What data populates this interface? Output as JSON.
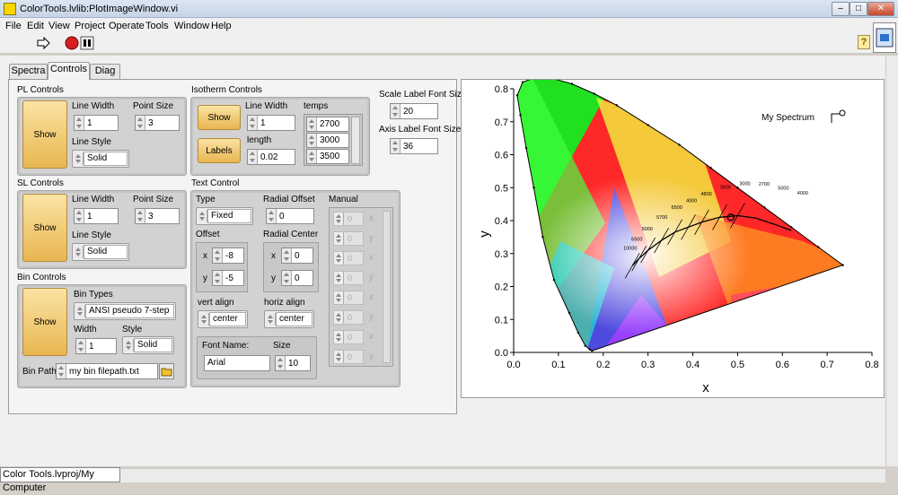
{
  "window": {
    "title": "ColorTools.lvlib:PlotImageWindow.vi",
    "min": "–",
    "max": "□",
    "close": "✕"
  },
  "menu": [
    "File",
    "Edit",
    "View",
    "Project",
    "Operate",
    "Tools",
    "Window",
    "Help"
  ],
  "help_label": "?",
  "tabs": [
    "Spectra",
    "Controls",
    "Diag"
  ],
  "pl": {
    "title": "PL Controls",
    "show": "Show",
    "line_width_label": "Line Width",
    "line_width": "1",
    "point_size_label": "Point Size",
    "point_size": "3",
    "line_style_label": "Line Style",
    "line_style": "Solid"
  },
  "isotherm": {
    "title": "Isotherm Controls",
    "show": "Show",
    "labels": "Labels",
    "line_width_label": "Line Width",
    "line_width": "1",
    "length_label": "length",
    "length": "0.02",
    "temps_label": "temps",
    "temps": [
      "2700",
      "3000",
      "3500"
    ]
  },
  "scale": {
    "scale_label": "Scale Label Font Size",
    "scale_value": "20",
    "axis_label": "Axis Label Font Size",
    "axis_value": "36"
  },
  "sl": {
    "title": "SL Controls",
    "show": "Show",
    "line_width_label": "Line Width",
    "line_width": "1",
    "point_size_label": "Point Size",
    "point_size": "3",
    "line_style_label": "Line Style",
    "line_style": "Solid"
  },
  "text": {
    "title": "Text Control",
    "type_label": "Type",
    "type": "Fixed",
    "radial_offset_label": "Radial Offset",
    "radial_offset": "0",
    "manual_label": "Manual",
    "offset_label": "Offset",
    "offset_x": "-8",
    "offset_y": "-5",
    "radial_center_label": "Radial Center",
    "rc_x": "0",
    "rc_y": "0",
    "vert_label": "vert align",
    "vert": "center",
    "horiz_label": "horiz align",
    "horiz": "center",
    "font_label": "Font Name:",
    "font": "Arial",
    "size_label": "Size",
    "size": "10",
    "x": "x",
    "y": "y",
    "manual_value": "0"
  },
  "bin": {
    "title": "Bin Controls",
    "show": "Show",
    "types_label": "Bin Types",
    "types": "ANSI pseudo 7-step",
    "width_label": "Width",
    "width": "1",
    "style_label": "Style",
    "style": "Solid",
    "path_label": "Bin Path",
    "path": "my bin filepath.txt"
  },
  "status": "Color Tools.lvproj/My Computer",
  "chart_data": {
    "type": "scatter",
    "xlabel": "x",
    "ylabel": "y",
    "xlim": [
      0,
      0.8
    ],
    "ylim": [
      0,
      0.8
    ],
    "xticks": [
      "0.0",
      "0.1",
      "0.2",
      "0.3",
      "0.4",
      "0.5",
      "0.6",
      "0.7",
      "0.8"
    ],
    "yticks": [
      "0.0",
      "0.1",
      "0.2",
      "0.3",
      "0.4",
      "0.5",
      "0.6",
      "0.7",
      "0.8"
    ],
    "legend": "My Spectrum",
    "spectrum_point": [
      0.485,
      0.41
    ],
    "isotherm_labels": [
      "10000",
      "6500",
      "5000",
      "5700",
      "6500",
      "4000",
      "4800",
      "3600",
      "3000",
      "2700",
      "5000",
      "4000"
    ],
    "locus": [
      [
        0.175,
        0.005
      ],
      [
        0.17,
        0.009
      ],
      [
        0.16,
        0.02
      ],
      [
        0.144,
        0.06
      ],
      [
        0.124,
        0.12
      ],
      [
        0.09,
        0.22
      ],
      [
        0.065,
        0.35
      ],
      [
        0.045,
        0.5
      ],
      [
        0.028,
        0.62
      ],
      [
        0.015,
        0.72
      ],
      [
        0.008,
        0.78
      ],
      [
        0.02,
        0.82
      ],
      [
        0.05,
        0.835
      ],
      [
        0.08,
        0.834
      ],
      [
        0.13,
        0.815
      ],
      [
        0.18,
        0.785
      ],
      [
        0.23,
        0.75
      ],
      [
        0.3,
        0.69
      ],
      [
        0.37,
        0.63
      ],
      [
        0.44,
        0.56
      ],
      [
        0.5,
        0.5
      ],
      [
        0.56,
        0.44
      ],
      [
        0.62,
        0.38
      ],
      [
        0.68,
        0.32
      ],
      [
        0.735,
        0.265
      ]
    ],
    "planckian": [
      [
        0.265,
        0.263
      ],
      [
        0.28,
        0.285
      ],
      [
        0.3,
        0.31
      ],
      [
        0.33,
        0.34
      ],
      [
        0.36,
        0.365
      ],
      [
        0.39,
        0.38
      ],
      [
        0.42,
        0.395
      ],
      [
        0.46,
        0.41
      ],
      [
        0.5,
        0.415
      ],
      [
        0.54,
        0.408
      ],
      [
        0.58,
        0.39
      ],
      [
        0.62,
        0.37
      ]
    ]
  }
}
